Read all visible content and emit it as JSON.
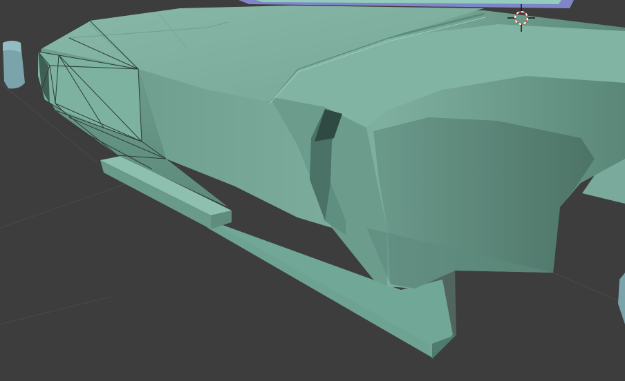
{
  "viewport": {
    "background_color": "#3d3d3d",
    "grid_line_color": "#4a4a4a",
    "mesh_base_color": "#79aa9a",
    "mesh_light_color": "#8cbcab",
    "mesh_shadow_color": "#4f7a6c",
    "mesh_dark_color": "#3f5f55",
    "window_trim_color": "#7e86c8",
    "window_glass_color": "#93cbbd",
    "edge_line_color": "#2d3b36"
  },
  "cursor": {
    "icon": "3d-cursor-icon",
    "ring_color_primary": "#e34a3a",
    "ring_color_secondary": "#ffffff"
  },
  "objects": [
    {
      "name": "car-body-mesh",
      "icon": "mesh-object"
    },
    {
      "name": "headlight-mesh",
      "icon": "mesh-object"
    },
    {
      "name": "side-mirror-mesh",
      "icon": "mesh-object"
    }
  ]
}
